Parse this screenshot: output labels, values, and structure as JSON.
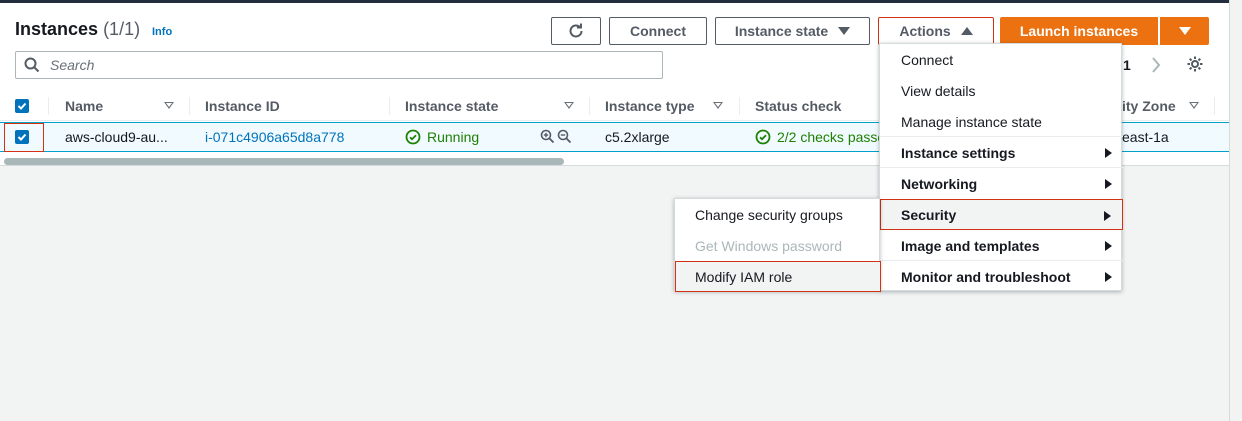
{
  "header": {
    "title": "Instances",
    "count": "(1/1)",
    "info": "Info"
  },
  "toolbar": {
    "refresh_icon": "refresh-icon",
    "connect_label": "Connect",
    "instance_state_label": "Instance state",
    "actions_label": "Actions",
    "launch_label": "Launch instances"
  },
  "search": {
    "placeholder": "Search"
  },
  "pagination": {
    "page": "1"
  },
  "table": {
    "columns": [
      "Name",
      "Instance ID",
      "Instance state",
      "Instance type",
      "Status check",
      "ity Zone"
    ],
    "rows": [
      {
        "name": "aws-cloud9-au...",
        "instance_id": "i-071c4906a65d8a778",
        "state": "Running",
        "type": "c5.2xlarge",
        "status": "2/2 checks passe",
        "zone": "east-1a"
      }
    ]
  },
  "actions_menu": {
    "items": [
      {
        "label": "Connect"
      },
      {
        "label": "View details"
      },
      {
        "label": "Manage instance state"
      },
      {
        "label": "Instance settings"
      },
      {
        "label": "Networking"
      },
      {
        "label": "Security"
      },
      {
        "label": "Image and templates"
      },
      {
        "label": "Monitor and troubleshoot"
      }
    ]
  },
  "security_submenu": {
    "items": [
      {
        "label": "Change security groups",
        "enabled": true
      },
      {
        "label": "Get Windows password",
        "enabled": false
      },
      {
        "label": "Modify IAM role",
        "enabled": true
      }
    ]
  },
  "colors": {
    "accent_orange": "#ec7211",
    "link_blue": "#0073bb",
    "success_green": "#1d8102",
    "highlight_red": "#d13212"
  }
}
